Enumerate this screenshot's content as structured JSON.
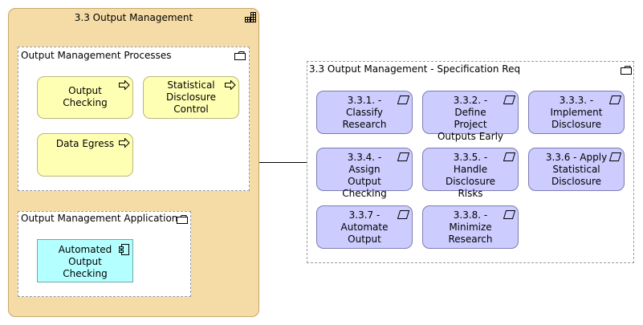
{
  "outer": {
    "title": "3.3 Output Management",
    "icon": "grid-icon"
  },
  "processes_group": {
    "label": "Output Management Processes",
    "icon": "folder-icon",
    "items": [
      {
        "label": "Output Checking",
        "icon": "process-arrow-icon"
      },
      {
        "label": "Statistical Disclosure Control",
        "icon": "process-arrow-icon"
      },
      {
        "label": "Data Egress",
        "icon": "process-arrow-icon"
      }
    ]
  },
  "application_group": {
    "label": "Output Management Application",
    "icon": "folder-icon",
    "items": [
      {
        "label": "Automated Output Checking",
        "icon": "component-icon"
      }
    ]
  },
  "spec_group": {
    "label": "3.3 Output Management - Specification Req",
    "icon": "folder-icon",
    "items": [
      {
        "label": "3.3.1. - Classify Research",
        "icon": "requirement-icon"
      },
      {
        "label": "3.3.2. - Define Project Outputs Early",
        "icon": "requirement-icon"
      },
      {
        "label": "3.3.3. - Implement Disclosure",
        "icon": "requirement-icon"
      },
      {
        "label": "3.3.4. - Assign Output Checking",
        "icon": "requirement-icon"
      },
      {
        "label": "3.3.5. - Handle Disclosure Risks",
        "icon": "requirement-icon"
      },
      {
        "label": "3.3.6 - Apply Statistical Disclosure",
        "icon": "requirement-icon"
      },
      {
        "label": "3.3.7 - Automate Output",
        "icon": "requirement-icon"
      },
      {
        "label": "3.3.8. - Minimize Research",
        "icon": "requirement-icon"
      }
    ]
  },
  "colors": {
    "outer_fill": "#f5dba5",
    "process_fill": "#ffffb4",
    "application_fill": "#b4ffff",
    "requirement_fill": "#ccccff"
  }
}
